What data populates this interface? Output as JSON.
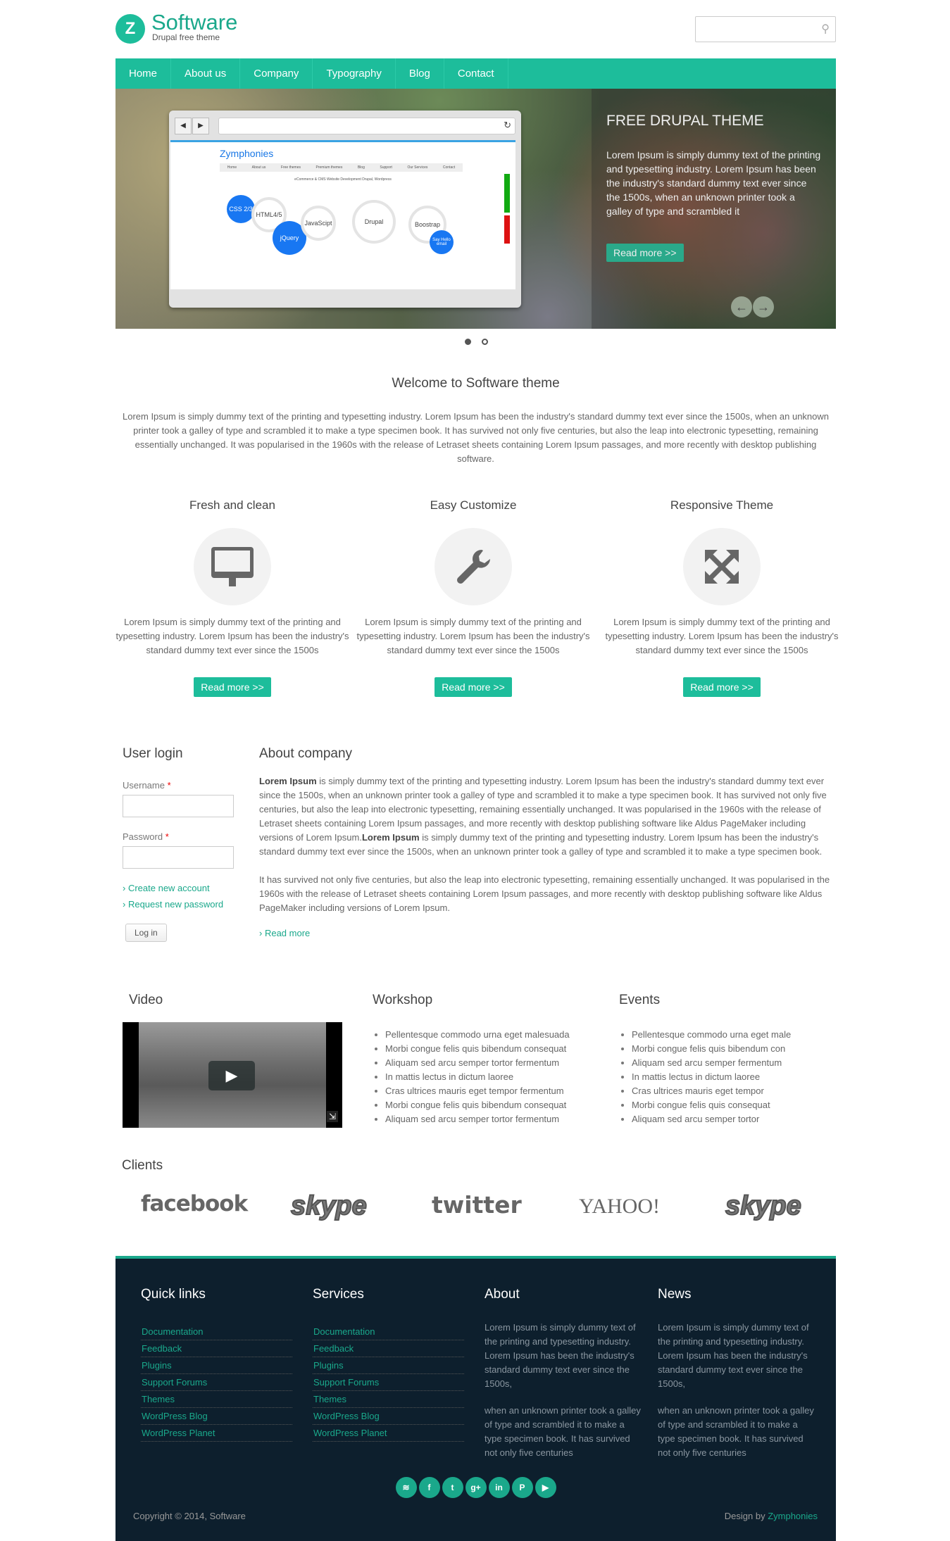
{
  "header": {
    "site_name": "Software",
    "slogan": "Drupal free theme",
    "search_placeholder": "",
    "search_icon": "search-icon"
  },
  "nav": [
    "Home",
    "About us",
    "Company",
    "Typography",
    "Blog",
    "Contact"
  ],
  "slider": {
    "title": "FREE DRUPAL THEME",
    "text": "Lorem Ipsum is simply dummy text of the printing and typesetting industry. Lorem Ipsum has been the industry's standard dummy text ever since the 1500s, when an unknown printer took a galley of type and scrambled it",
    "button": "Read more >>",
    "slide_count": 2,
    "active_slide": 1,
    "screenshot": {
      "logo": "Zymphonies",
      "tagline": "eCommerce & CMS Website Development Drupal, Wordpress",
      "nav": [
        "Home",
        "About us",
        "Free themes",
        "Premium themes",
        "Blog",
        "Support",
        "Our Services",
        "Contact"
      ],
      "bubbles": [
        "CSS 2/3",
        "HTML4/5",
        "jQuery",
        "JavaScipt",
        "Drupal",
        "Boostrap",
        "Say Hello email"
      ]
    }
  },
  "welcome": {
    "title": "Welcome to Software theme",
    "text": "Lorem Ipsum is simply dummy text of the printing and typesetting industry. Lorem Ipsum has been the industry's standard dummy text ever since the 1500s, when an unknown printer took a galley of type and scrambled it to make a type specimen book. It has survived not only five centuries, but also the leap into electronic typesetting, remaining essentially unchanged. It was popularised in the 1960s with the release of Letraset sheets containing Lorem Ipsum passages, and more recently with desktop publishing software."
  },
  "features": [
    {
      "title": "Fresh and clean",
      "icon": "monitor-icon",
      "text": "Lorem Ipsum is simply dummy text of the printing and typesetting industry. Lorem Ipsum has been the industry's standard dummy text ever since the 1500s",
      "button": "Read more >>"
    },
    {
      "title": "Easy Customize",
      "icon": "wrench-icon",
      "text": "Lorem Ipsum is simply dummy text of the printing and typesetting industry. Lorem Ipsum has been the industry's standard dummy text ever since the 1500s",
      "button": "Read more >>"
    },
    {
      "title": "Responsive Theme",
      "icon": "expand-icon",
      "text": "Lorem Ipsum is simply dummy text of the printing and typesetting industry. Lorem Ipsum has been the industry's standard dummy text ever since the 1500s",
      "button": "Read more >>"
    }
  ],
  "login": {
    "title": "User login",
    "username_label": "Username",
    "password_label": "Password",
    "required": "*",
    "create_account": "Create new account",
    "request_password": "Request new password",
    "button": "Log in"
  },
  "about": {
    "title": "About company",
    "p1_bold1": "Lorem Ipsum",
    "p1_a": " is simply dummy text of the printing and typesetting industry. Lorem Ipsum has been the industry's standard dummy text ever since the 1500s, when an unknown printer took a galley of type and scrambled it to make a type specimen book. It has survived not only five centuries, but also the leap into electronic typesetting, remaining essentially unchanged. It was popularised in the 1960s with the release of Letraset sheets containing Lorem Ipsum passages, and more recently with desktop publishing software like Aldus PageMaker including versions of Lorem Ipsum.",
    "p1_bold2": "Lorem Ipsum",
    "p1_b": " is simply dummy text of the printing and typesetting industry. Lorem Ipsum has been the industry's standard dummy text ever since the 1500s, when an unknown printer took a galley of type and scrambled it to make a type specimen book.",
    "p2": "It has survived not only five centuries, but also the leap into electronic typesetting, remaining essentially unchanged. It was popularised in the 1960s with the release of Letraset sheets containing Lorem Ipsum passages, and more recently with desktop publishing software like Aldus PageMaker including versions of Lorem Ipsum.",
    "read_more": "Read more"
  },
  "video": {
    "title": "Video"
  },
  "workshop": {
    "title": "Workshop",
    "items": [
      "Pellentesque commodo urna eget malesuada",
      "Morbi congue felis quis bibendum consequat",
      "Aliquam sed arcu semper tortor fermentum",
      "In mattis lectus in dictum laoree",
      "Cras ultrices mauris eget tempor fermentum",
      "Morbi congue felis quis bibendum consequat",
      "Aliquam sed arcu semper tortor fermentum"
    ]
  },
  "events": {
    "title": "Events",
    "items": [
      "Pellentesque commodo urna eget male",
      "Morbi congue felis quis bibendum con",
      "Aliquam sed arcu semper fermentum",
      "In mattis lectus in dictum laoree",
      "Cras ultrices mauris eget tempor",
      "Morbi congue felis quis consequat",
      "Aliquam sed arcu semper tortor"
    ]
  },
  "clients": {
    "title": "Clients",
    "logos": [
      "facebook",
      "skype",
      "twitter",
      "YAHOO!",
      "skype"
    ]
  },
  "footer": {
    "quick_links": {
      "title": "Quick links",
      "items": [
        "Documentation",
        "Feedback",
        "Plugins",
        "Support Forums",
        "Themes",
        "WordPress Blog",
        "WordPress Planet"
      ]
    },
    "services": {
      "title": "Services",
      "items": [
        "Documentation",
        "Feedback",
        "Plugins",
        "Support Forums",
        "Themes",
        "WordPress Blog",
        "WordPress Planet"
      ]
    },
    "about": {
      "title": "About",
      "p1": "Lorem Ipsum is simply dummy text of the printing and typesetting industry. Lorem Ipsum has been the industry's standard dummy text ever since the 1500s,",
      "p2": "when an unknown printer took a galley of type and scrambled it to make a type specimen book. It has survived not only five centuries"
    },
    "news": {
      "title": "News",
      "p1": "Lorem Ipsum is simply dummy text of the printing and typesetting industry. Lorem Ipsum has been the industry's standard dummy text ever since the 1500s,",
      "p2": "when an unknown printer took a galley of type and scrambled it to make a type specimen book. It has survived not only five centuries"
    },
    "social": [
      "rss-icon",
      "facebook-icon",
      "twitter-icon",
      "google-plus-icon",
      "linkedin-icon",
      "pinterest-icon",
      "youtube-icon"
    ],
    "copyright": "Copyright © 2014, Software",
    "credit_prefix": "Design by ",
    "credit_link": "Zymphonies"
  },
  "colors": {
    "accent": "#1dbd9b",
    "footer_bg": "#0d1f2d",
    "link": "#1aa88b"
  }
}
